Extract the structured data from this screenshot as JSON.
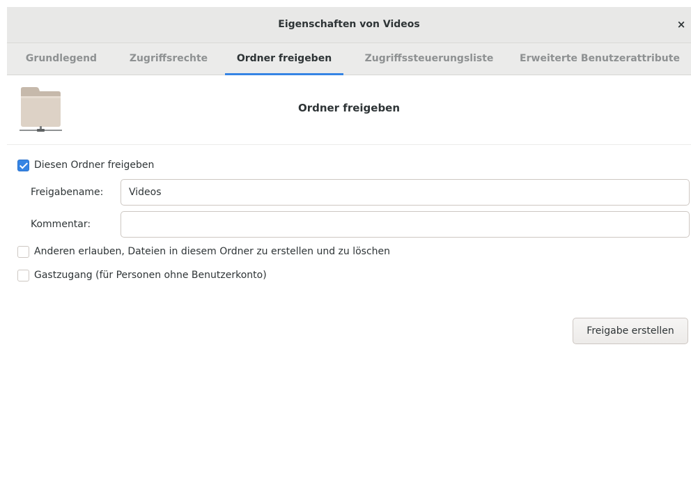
{
  "window": {
    "title": "Eigenschaften von Videos",
    "close_icon": "close-icon",
    "close_glyph": "×"
  },
  "tabs": [
    {
      "label": "Grundlegend",
      "active": false
    },
    {
      "label": "Zugriffsrechte",
      "active": false
    },
    {
      "label": "Ordner freigeben",
      "active": true
    },
    {
      "label": "Zugriffssteuerungsliste",
      "active": false
    },
    {
      "label": "Erweiterte Benutzerattribute",
      "active": false
    }
  ],
  "section": {
    "icon": "shared-folder-icon",
    "title": "Ordner freigeben"
  },
  "form": {
    "share_checkbox": {
      "label": "Diesen Ordner freigeben",
      "checked": true
    },
    "share_name": {
      "label": "Freigabename:",
      "value": "Videos"
    },
    "comment": {
      "label": "Kommentar:",
      "value": ""
    },
    "allow_others_checkbox": {
      "label": "Anderen erlauben, Dateien in diesem Ordner zu erstellen und zu löschen",
      "checked": false
    },
    "guest_checkbox": {
      "label": "Gastzugang (für Personen ohne Benutzerkonto)",
      "checked": false
    },
    "create_button": "Freigabe erstellen"
  },
  "colors": {
    "accent": "#3584e4",
    "folder": "#d6cbbf",
    "headerbar": "#e8e8e7"
  }
}
